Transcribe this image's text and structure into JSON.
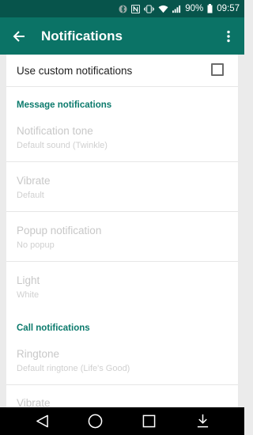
{
  "status_bar": {
    "battery_percent": "90%",
    "time": "09:57",
    "icons": [
      "bluetooth-icon",
      "nfc-icon",
      "vibrate-icon",
      "wifi-icon",
      "signal-icon",
      "battery-icon"
    ]
  },
  "app_bar": {
    "title": "Notifications",
    "back_icon": "arrow-back-icon",
    "menu_icon": "more-vert-icon"
  },
  "custom": {
    "label": "Use custom notifications",
    "checked": false
  },
  "message_section": {
    "header": "Message notifications",
    "items": [
      {
        "title": "Notification tone",
        "subtitle": "Default sound (Twinkle)"
      },
      {
        "title": "Vibrate",
        "subtitle": "Default"
      },
      {
        "title": "Popup notification",
        "subtitle": "No popup"
      },
      {
        "title": "Light",
        "subtitle": "White"
      }
    ]
  },
  "call_section": {
    "header": "Call notifications",
    "items": [
      {
        "title": "Ringtone",
        "subtitle": "Default ringtone (Life's Good)"
      },
      {
        "title": "Vibrate",
        "subtitle": ""
      }
    ]
  },
  "nav_bar": {
    "icons": [
      "back-triangle-icon",
      "home-circle-icon",
      "recents-square-icon",
      "notification-pulldown-icon"
    ]
  },
  "colors": {
    "status_bar": "#07544b",
    "app_bar": "#0b7366",
    "accent": "#0b7a6c"
  }
}
